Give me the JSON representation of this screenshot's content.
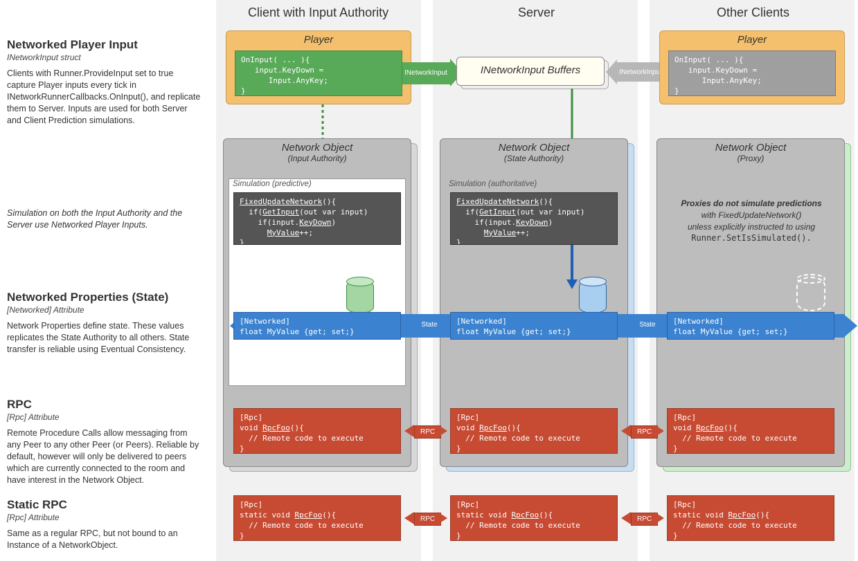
{
  "headers": {
    "col1": "Client with Input Authority",
    "col2": "Server",
    "col3": "Other Clients"
  },
  "side": {
    "s1": {
      "title": "Networked Player Input",
      "sub": "INetworkInput struct",
      "body": "Clients with Runner.ProvideInput set to true capture Player inputs every tick in INetworkRunnerCallbacks.OnInput(), and replicate them to Server. Inputs are used for both Server and Client Prediction simulations."
    },
    "s2": {
      "body": "Simulation on both the Input Authority and the Server use Networked Player Inputs."
    },
    "s3": {
      "title": "Networked Properties (State)",
      "sub": "[Networked] Attribute",
      "body": "Network Properties define state. These values replicates the State Authority to all others. State transfer is reliable using Eventual Consistency."
    },
    "s4": {
      "title": "RPC",
      "sub": "[Rpc] Attribute",
      "body": "Remote Procedure Calls allow messaging from any Peer to any other Peer (or Peers). Reliable by default, however will only be delivered to peers which are currently connected to the room and have interest in  the Network Object."
    },
    "s5": {
      "title": "Static RPC",
      "sub": "[Rpc] Attribute",
      "body": "Same as a regular RPC, but not bound to an Instance of a NetworkObject."
    }
  },
  "labels": {
    "player": "Player",
    "netobj": "Network Object",
    "inputauth": "(Input Authority)",
    "stateauth": "(State Authority)",
    "proxy": "(Proxy)",
    "simpred": "Simulation (predictive)",
    "simauth": "Simulation (authoritative)",
    "buffers": "INetworkInput Buffers",
    "inetinput": "INetworkInput",
    "state": "State",
    "rpc": "RPC"
  },
  "proxyNote": {
    "l1": "Proxies do not simulate predictions",
    "l2": "with FixedUpdateNetwork()",
    "l3": "unless explicitly instructed to using",
    "l4": "Runner.SetIsSimulated()."
  },
  "code": {
    "oninput": "OnInput( ... ){\n   input.KeyDown =\n      Input.AnyKey;\n}",
    "fixedupdate": "FixedUpdateNetwork(){\n  if(GetInput(out var input)\n    if(input.KeyDown)\n      MyValue++;\n}",
    "networked": "[Networked]\nfloat MyValue {get; set;}",
    "rpc": "[Rpc]\nvoid RpcFoo(){\n  // Remote code to execute\n}",
    "staticrpc": "[Rpc]\nstatic void RpcFoo(){\n  // Remote code to execute\n}"
  }
}
